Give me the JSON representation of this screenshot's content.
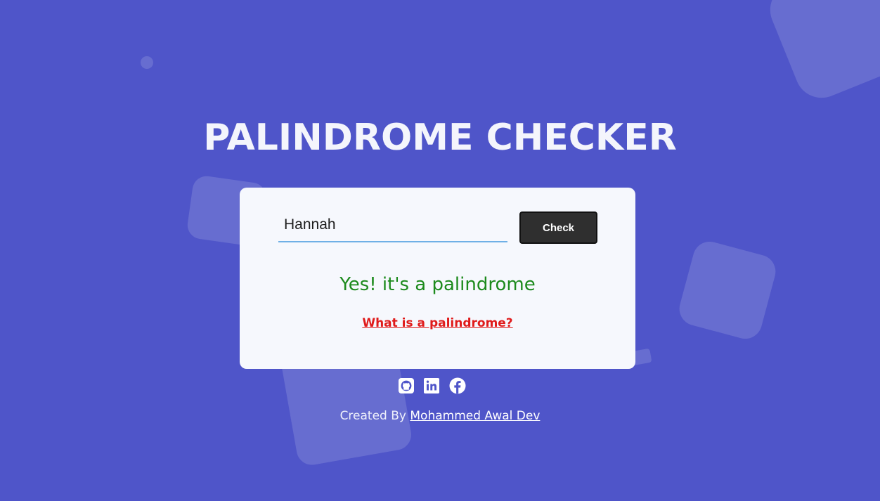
{
  "page": {
    "title": "PALINDROME CHECKER",
    "background_color": "#4f55c9"
  },
  "checker": {
    "input_value": "Hannah",
    "check_label": "Check",
    "result_text": "Yes! it's a palindrome",
    "result_color": "#1c8a1c",
    "info_link": "What is a palindrome?",
    "info_link_color": "#e01b1b"
  },
  "socials": [
    {
      "name": "github-icon"
    },
    {
      "name": "linkedin-icon"
    },
    {
      "name": "facebook-icon"
    }
  ],
  "footer": {
    "prefix": "Created By",
    "author": "Mohammed Awal Dev"
  }
}
